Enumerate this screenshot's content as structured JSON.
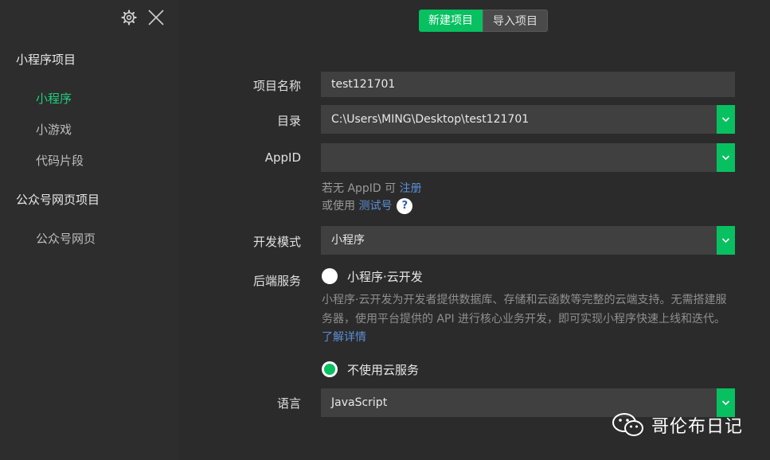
{
  "sidebar": {
    "settings_icon": "gear-icon",
    "close_icon": "close-icon",
    "group1_title": "小程序项目",
    "group1_items": [
      "小程序",
      "小游戏",
      "代码片段"
    ],
    "group2_title": "公众号网页项目",
    "group2_items": [
      "公众号网页"
    ]
  },
  "tabs": {
    "new": "新建项目",
    "import": "导入项目"
  },
  "form": {
    "name_label": "项目名称",
    "name_value": "test121701",
    "dir_label": "目录",
    "dir_value": "C:\\Users\\MING\\Desktop\\test121701",
    "appid_label": "AppID",
    "appid_value": "",
    "hint1_text": "若无 AppID 可 ",
    "hint1_link": "注册",
    "hint2_text": "或使用 ",
    "hint2_link": "测试号",
    "help_icon": "?",
    "mode_label": "开发模式",
    "mode_value": "小程序",
    "backend_label": "后端服务",
    "cloud_option": "小程序·云开发",
    "cloud_desc": "小程序·云开发为开发者提供数据库、存储和云函数等完整的云端支持。无需搭建服务器，使用平台提供的 API 进行核心业务开发，即可实现小程序快速上线和迭代。",
    "cloud_desc_link": "了解详情",
    "nocloud_option": "不使用云服务",
    "lang_label": "语言",
    "lang_value": "JavaScript"
  },
  "watermark": {
    "text": "哥伦布日记",
    "icon": "wechat-icon"
  },
  "colors": {
    "accent": "#07c160",
    "link": "#5b8fd6",
    "bg": "#2b2b2b"
  }
}
